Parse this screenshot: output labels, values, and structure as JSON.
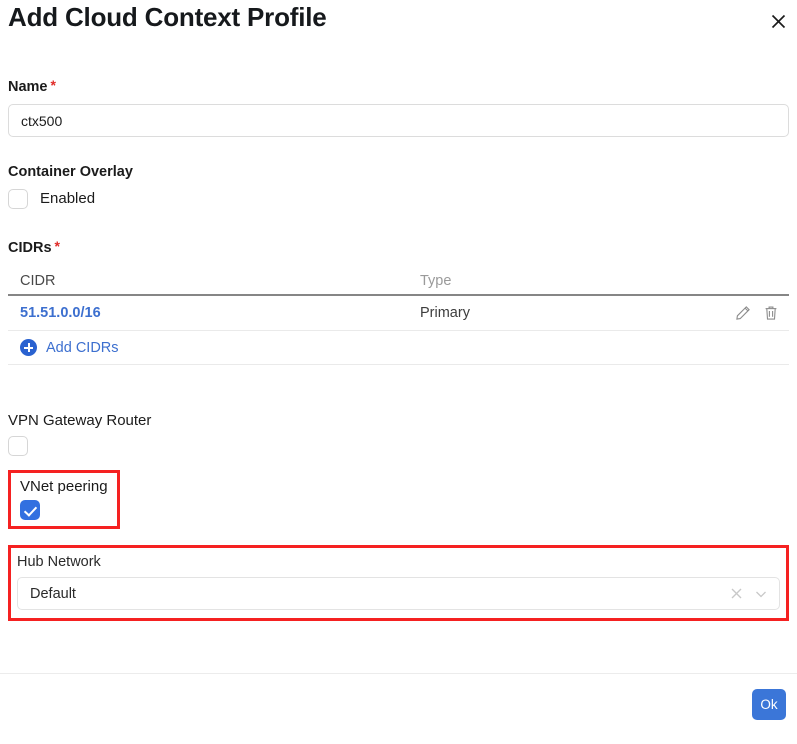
{
  "dialog": {
    "title": "Add Cloud Context Profile",
    "close_icon": "close-icon"
  },
  "name_field": {
    "label": "Name",
    "required_marker": "*",
    "value": "ctx500"
  },
  "container_overlay": {
    "label": "Container Overlay",
    "checkbox_label": "Enabled",
    "checked": false
  },
  "cidrs": {
    "label": "CIDRs",
    "required_marker": "*",
    "columns": [
      "CIDR",
      "Type"
    ],
    "rows": [
      {
        "cidr": "51.51.0.0/16",
        "type": "Primary",
        "edit_icon": "pencil-icon",
        "delete_icon": "trash-icon"
      }
    ],
    "add_link": "Add CIDRs",
    "add_icon": "plus-circle-icon"
  },
  "vpn_gateway_router": {
    "label": "VPN Gateway Router",
    "checked": false
  },
  "vnet_peering": {
    "label": "VNet peering",
    "checked": true,
    "highlight_color": "#f52121"
  },
  "hub_network": {
    "label": "Hub Network",
    "value": "Default",
    "clear_icon": "close-icon",
    "dropdown_icon": "chevron-down-icon",
    "highlight_color": "#f52121"
  },
  "footer": {
    "ok_label": "Ok"
  },
  "colors": {
    "accent_blue": "#3270e0",
    "link_blue": "#3c6fcf",
    "required_red": "#e02b27",
    "highlight_red": "#f52121"
  }
}
